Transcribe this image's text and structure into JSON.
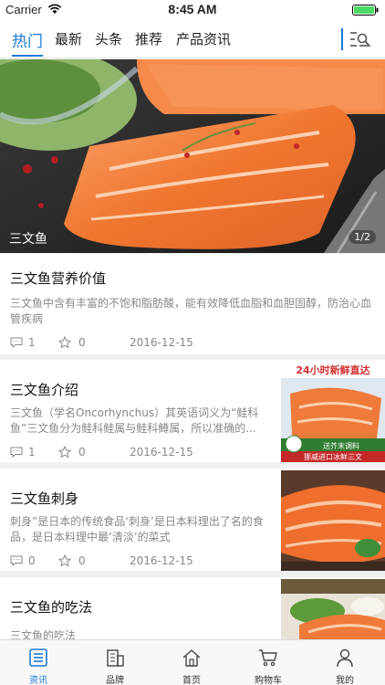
{
  "status": {
    "carrier": "Carrier",
    "time": "8:45 AM"
  },
  "top_tabs": [
    {
      "label": "热门",
      "active": true
    },
    {
      "label": "最新"
    },
    {
      "label": "头条"
    },
    {
      "label": "推荐"
    },
    {
      "label": "产品资讯"
    }
  ],
  "icons": {
    "menu": "list-menu-icon",
    "comment": "comment-icon",
    "star": "star-icon"
  },
  "hero": {
    "caption": "三文鱼",
    "counter": "1/2"
  },
  "feature": {
    "title": "三文鱼营养价值",
    "summary": "三文鱼中含有丰富的不饱和脂肪酸，能有效降低血脂和血胆固醇，防治心血管疾病",
    "comments": "1",
    "stars": "0",
    "date": "2016-12-15"
  },
  "articles": [
    {
      "title": "三文鱼介绍",
      "summary": "三文鱼（学名Oncorhynchus）其英语词义为“鲑科鱼”三文鱼分为鲑科鲑属与鲑科鳟属，所以准确的...",
      "comments": "1",
      "stars": "0",
      "date": "2016-12-15",
      "thumb_banner": "24小时新鲜直达",
      "thumb_badge1": "送芥末调料",
      "thumb_badge2": "挪威进口冰鲜三文"
    },
    {
      "title": "三文鱼刺身",
      "summary": "刺身”是日本的传统食品‘刺身’是日本料理出了名的食品，是日本料理中最‘清淡’的菜式",
      "comments": "0",
      "stars": "0",
      "date": "2016-12-15"
    },
    {
      "title": "三文鱼的吃法",
      "summary": "三文鱼的吃法"
    }
  ],
  "bottom_nav": [
    {
      "label": "资讯",
      "icon": "news-icon",
      "active": true
    },
    {
      "label": "品牌",
      "icon": "brand-icon"
    },
    {
      "label": "首页",
      "icon": "home-icon"
    },
    {
      "label": "购物车",
      "icon": "cart-icon"
    },
    {
      "label": "我的",
      "icon": "profile-icon"
    }
  ],
  "colors": {
    "accent": "#1a7bd6",
    "salmon": "#f07a3a"
  }
}
